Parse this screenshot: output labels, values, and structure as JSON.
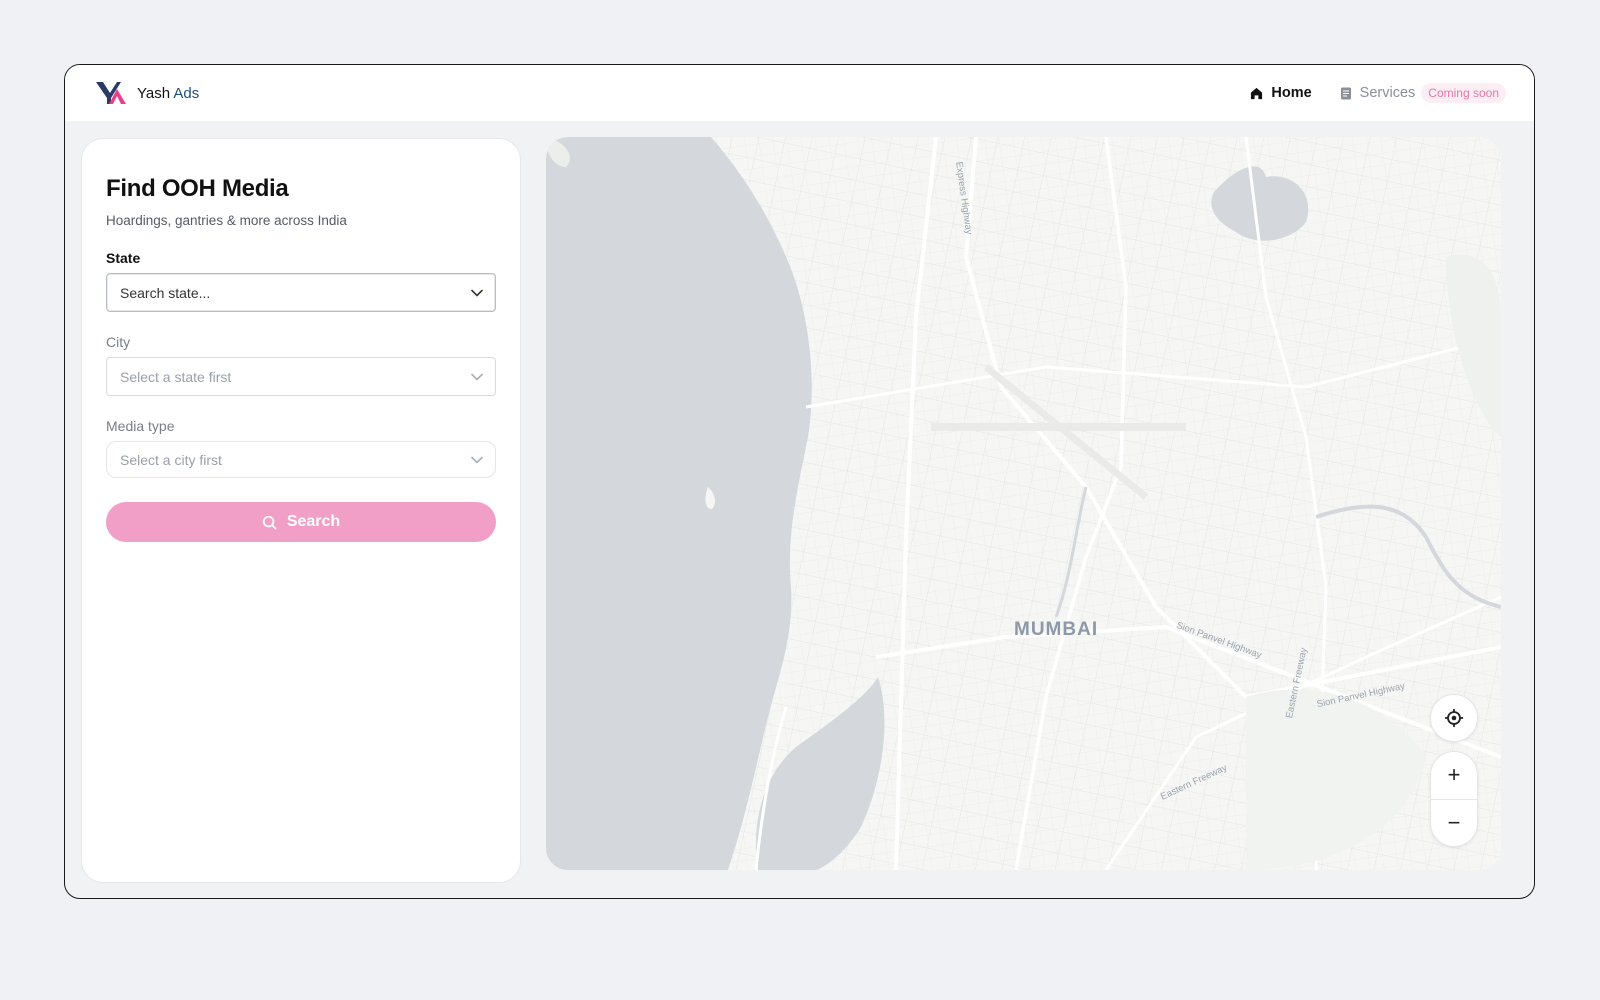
{
  "header": {
    "brand_first": "Yash",
    "brand_second": "Ads",
    "nav": [
      {
        "label": "Home",
        "icon": "home-icon",
        "active": true
      },
      {
        "label": "Services",
        "icon": "document-icon",
        "active": false
      }
    ],
    "services_badge": "Coming soon"
  },
  "panel": {
    "title": "Find OOH Media",
    "subtitle": "Hoardings, gantries & more across India",
    "state": {
      "label": "State",
      "placeholder": "Search state..."
    },
    "city": {
      "label": "City",
      "placeholder": "Select a state first"
    },
    "media_type": {
      "label": "Media type",
      "placeholder": "Select a city first"
    },
    "search_label": "Search"
  },
  "map": {
    "city_label": "MUMBAI",
    "road_labels": {
      "express": "Express Highway",
      "sion1": "Sion Panvel Highway",
      "sion2": "Sion Panvel Highway",
      "eastern_freeway": "Eastern Freeway",
      "eastern_express": "Eastern Freeway"
    },
    "zoom_in": "+",
    "zoom_out": "−"
  },
  "colors": {
    "accent": "#f19fc6",
    "badge_text": "#e178a6",
    "brand_blue": "#1e4e7a",
    "water": "#d4d8dc"
  }
}
